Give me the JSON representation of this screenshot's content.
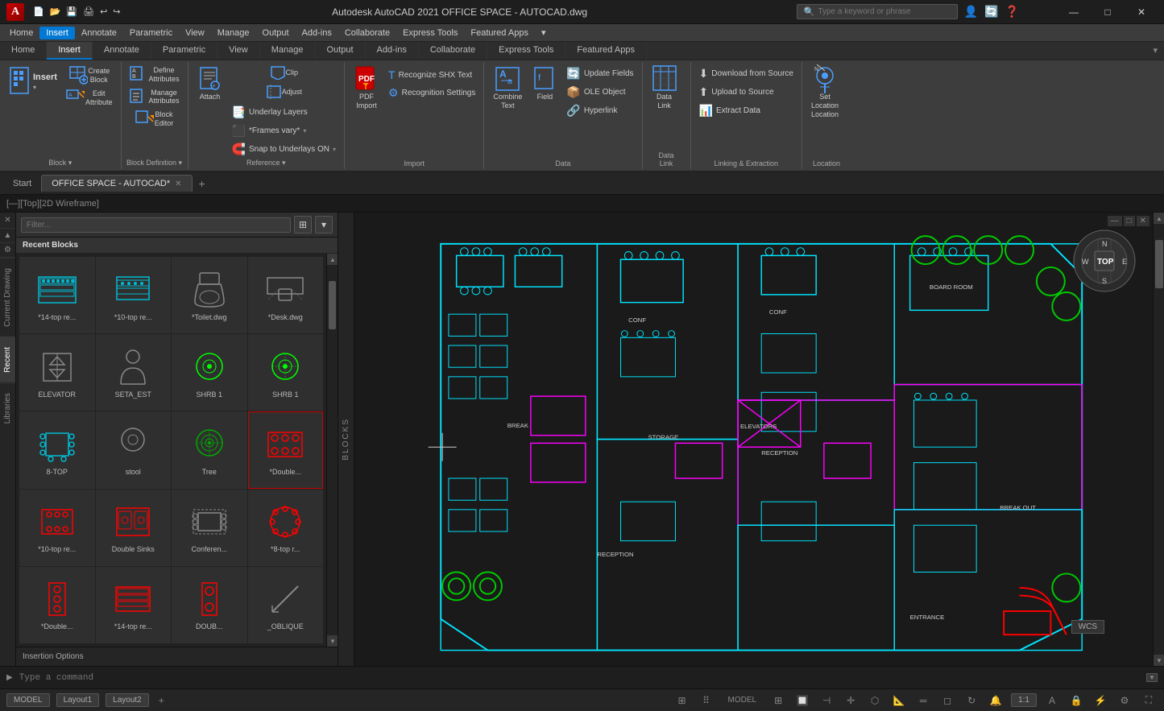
{
  "titleBar": {
    "appIcon": "A",
    "title": "Autodesk AutoCAD 2021  OFFICE SPACE - AUTOCAD.dwg",
    "searchPlaceholder": "Type a keyword or phrase",
    "winBtns": [
      "—",
      "□",
      "✕"
    ]
  },
  "menuBar": {
    "items": [
      "Home",
      "Insert",
      "Annotate",
      "Parametric",
      "View",
      "Manage",
      "Output",
      "Add-ins",
      "Collaborate",
      "Express Tools",
      "Featured Apps",
      "▾"
    ]
  },
  "ribbon": {
    "activeTab": "Insert",
    "tabs": [
      "Home",
      "Insert",
      "Annotate",
      "Parametric",
      "View",
      "Manage",
      "Output",
      "Add-ins",
      "Collaborate",
      "Express Tools",
      "Featured Apps"
    ],
    "groups": [
      {
        "name": "Block",
        "label": "Block ▾",
        "buttons": [
          {
            "id": "insert",
            "icon": "⬛",
            "label": "Insert",
            "hasArrow": true
          },
          {
            "id": "create-block",
            "icon": "🔲",
            "label": "Create\nBlock"
          },
          {
            "id": "edit-attribute",
            "icon": "✏️",
            "label": "Edit\nAttribute"
          }
        ]
      },
      {
        "name": "BlockDefinition",
        "label": "Block Definition ▾",
        "buttons": [
          {
            "id": "define-attributes",
            "icon": "🏷",
            "label": "Define\nAttributes"
          },
          {
            "id": "manage-attributes",
            "icon": "📋",
            "label": "Manage\nAttributes"
          },
          {
            "id": "block-editor",
            "icon": "✏",
            "label": "Block\nEditor"
          }
        ]
      },
      {
        "name": "Reference",
        "label": "Reference ▾",
        "buttons": [
          {
            "id": "attach",
            "icon": "📎",
            "label": "Attach"
          },
          {
            "id": "clip",
            "icon": "✂",
            "label": "Clip"
          },
          {
            "id": "adjust",
            "icon": "🎛",
            "label": "Adjust"
          }
        ],
        "smallButtons": [
          {
            "id": "underlay-layers",
            "label": "Underlay Layers"
          },
          {
            "id": "frames-vary",
            "label": "*Frames vary*",
            "hasArrow": true
          },
          {
            "id": "snap-to-underlays",
            "label": "Snap to Underlays ON",
            "hasArrow": true
          }
        ]
      },
      {
        "name": "Import",
        "label": "Import",
        "buttons": [
          {
            "id": "pdf-import",
            "icon": "📄",
            "label": "PDF\nImport"
          }
        ],
        "smallButtons": [
          {
            "id": "recognize-shx",
            "label": "Recognize SHX Text"
          },
          {
            "id": "recognition-settings",
            "label": "Recognition Settings"
          }
        ]
      },
      {
        "name": "Data",
        "label": "Data",
        "buttons": [
          {
            "id": "combine-text",
            "icon": "𝐓",
            "label": "Combine\nText"
          },
          {
            "id": "field",
            "icon": "⬜",
            "label": "Field"
          }
        ],
        "smallButtons": [
          {
            "id": "update-fields",
            "label": "Update Fields"
          },
          {
            "id": "ole-object",
            "label": "OLE Object"
          },
          {
            "id": "hyperlink",
            "label": "Hyperlink"
          }
        ]
      },
      {
        "name": "DataLink",
        "label": "Data\nLink",
        "buttons": [
          {
            "id": "data-link",
            "icon": "🔗",
            "label": "Data\nLink"
          }
        ]
      },
      {
        "name": "LinkingExtraction",
        "label": "Linking & Extraction",
        "buttons": [],
        "smallButtons": [
          {
            "id": "download-from-source",
            "label": "Download from Source"
          },
          {
            "id": "upload-to-source",
            "label": "Upload to Source"
          },
          {
            "id": "extract-data",
            "label": "Extract  Data"
          }
        ]
      },
      {
        "name": "Location",
        "label": "Location",
        "buttons": [
          {
            "id": "set-location",
            "icon": "📍",
            "label": "Set\nLocation\nLocation"
          }
        ]
      }
    ]
  },
  "tabBar": {
    "startTab": "Start",
    "fileTabs": [
      {
        "name": "OFFICE SPACE - AUTOCAD*",
        "active": true
      }
    ]
  },
  "viewportLabel": "[—][Top][2D Wireframe]",
  "blocksPanel": {
    "filterPlaceholder": "Filter...",
    "recentBlocksHeader": "Recent Blocks",
    "blocks": [
      {
        "id": "b1",
        "label": "*14-top re...",
        "type": "table-cyan"
      },
      {
        "id": "b2",
        "label": "*10-top re...",
        "type": "table-cyan-small"
      },
      {
        "id": "b3",
        "label": "*Toilet.dwg",
        "type": "toilet"
      },
      {
        "id": "b4",
        "label": "*Desk.dwg",
        "type": "desk"
      },
      {
        "id": "b5",
        "label": "ELEVATOR",
        "type": "elevator"
      },
      {
        "id": "b6",
        "label": "SETA_EST",
        "type": "person"
      },
      {
        "id": "b7",
        "label": "SHRB 1",
        "type": "shrub"
      },
      {
        "id": "b8",
        "label": "SHRB 1",
        "type": "shrub2"
      },
      {
        "id": "b9",
        "label": "8-TOP",
        "type": "8top"
      },
      {
        "id": "b10",
        "label": "stool",
        "type": "stool"
      },
      {
        "id": "b11",
        "label": "Tree",
        "type": "tree"
      },
      {
        "id": "b12",
        "label": "*Double...",
        "type": "double-red"
      },
      {
        "id": "b13",
        "label": "*10-top re...",
        "type": "10top-red"
      },
      {
        "id": "b14",
        "label": "Double Sinks",
        "type": "double-sinks"
      },
      {
        "id": "b15",
        "label": "Conferen...",
        "type": "conf-table"
      },
      {
        "id": "b16",
        "label": "*8-top r...",
        "type": "8top-circle"
      },
      {
        "id": "b17",
        "label": "*Double...",
        "type": "double-red2"
      },
      {
        "id": "b18",
        "label": "*14-top re...",
        "type": "14top-red"
      },
      {
        "id": "b19",
        "label": "DOUB...",
        "type": "doub-red"
      },
      {
        "id": "b20",
        "label": "_OBLIQUE",
        "type": "oblique"
      }
    ],
    "insertionOptionsLabel": "Insertion Options",
    "sideTabs": [
      "Current Drawing",
      "Recent",
      "Libraries"
    ],
    "vertLabel": "BLOCKS"
  },
  "statusBar": {
    "modelBtn": "MODEL",
    "gridIcons": [
      "⊞",
      "⠿"
    ],
    "wcsLabel": "WCS",
    "commandPromptPlaceholder": "Type a command",
    "layoutTabs": [
      "Model",
      "Layout1",
      "Layout2"
    ],
    "scaleLabel": "1:1"
  },
  "compass": {
    "n": "N",
    "s": "S",
    "e": "E",
    "w": "W",
    "center": "TOP"
  }
}
